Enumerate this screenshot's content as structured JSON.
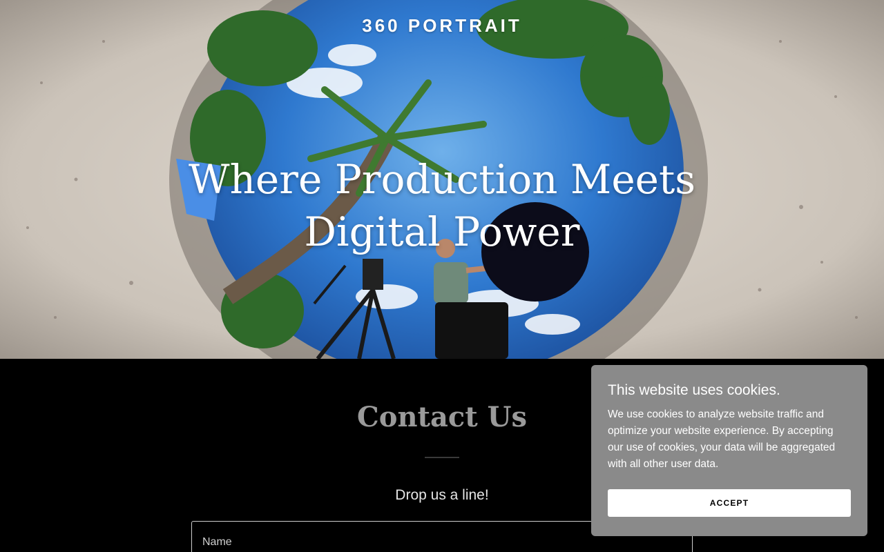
{
  "hero": {
    "brand": "360 PORTRAIT",
    "headline": "Where Production Meets Digital Power",
    "image": "360 tiny-planet beach photo with palm trees, camera tripod, person holding umbrella"
  },
  "contact": {
    "title": "Contact Us",
    "subtitle": "Drop us a line!",
    "name_placeholder": "Name"
  },
  "cookie_banner": {
    "title": "This website uses cookies.",
    "body": "We use cookies to analyze website traffic and optimize your website experience. By accepting our use of cookies, your data will be aggregated with all other user data.",
    "accept_label": "ACCEPT"
  },
  "colors": {
    "page_background": "#000000",
    "banner_background": "#8a8a8a",
    "sky": "#3f86d6"
  }
}
